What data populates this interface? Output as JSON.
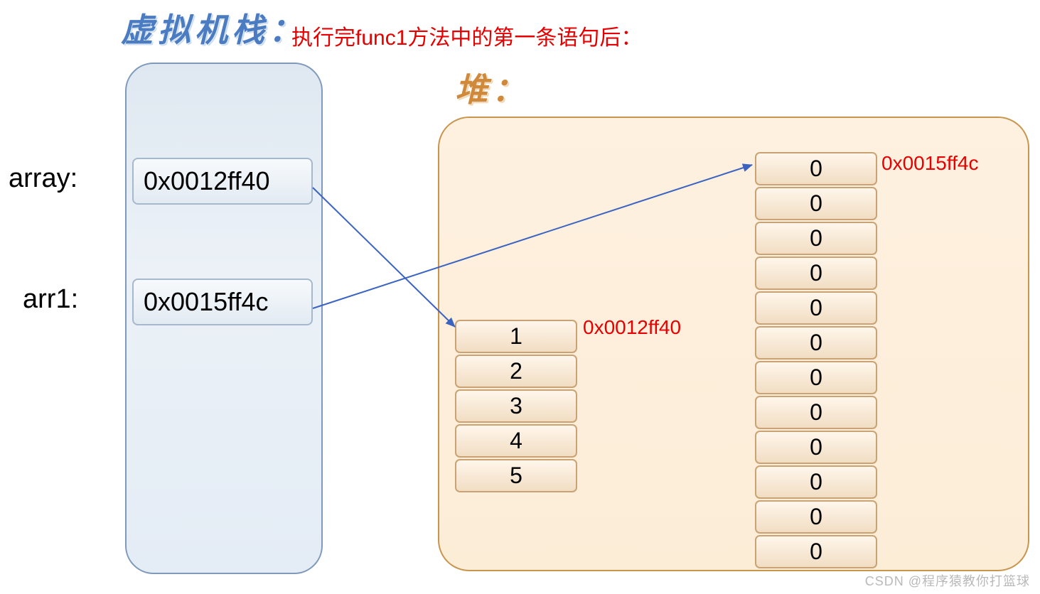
{
  "titles": {
    "stack": "虚拟机栈：",
    "heap": "堆：",
    "caption": "执行完func1方法中的第一条语句后："
  },
  "stack": {
    "label1": "array:",
    "label2": "arr1:",
    "value1": "0x0012ff40",
    "value2": "0x0015ff4c"
  },
  "heap": {
    "small_addr": "0x0012ff40",
    "large_addr": "0x0015ff4c",
    "small_values": [
      "1",
      "2",
      "3",
      "4",
      "5"
    ],
    "large_values": [
      "0",
      "0",
      "0",
      "0",
      "0",
      "0",
      "0",
      "0",
      "0",
      "0",
      "0",
      "0"
    ]
  },
  "watermark": "CSDN @程序猿教你打篮球"
}
